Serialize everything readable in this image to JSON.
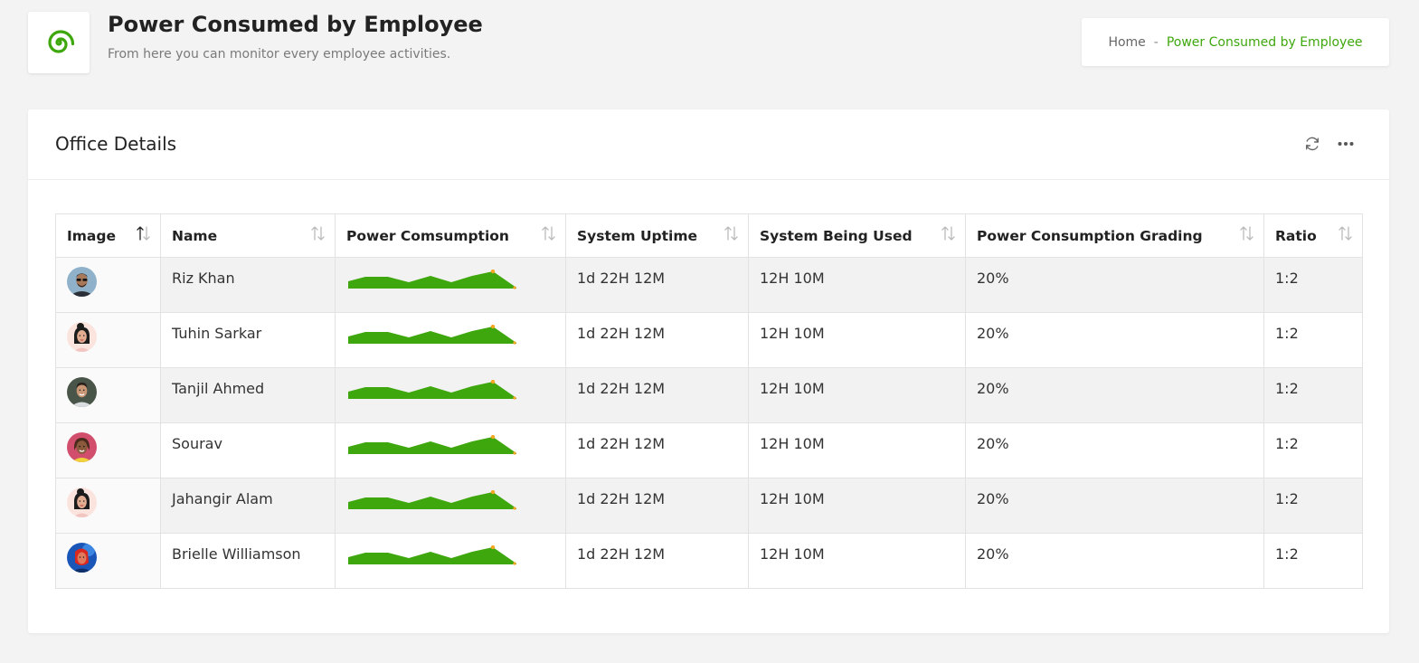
{
  "header": {
    "logo_icon": "green-spiral-logo",
    "title": "Power Consumed by Employee",
    "subtitle": "From here you can monitor every employee activities."
  },
  "breadcrumb": {
    "home": "Home",
    "separator": "-",
    "current": "Power Consumed by Employee"
  },
  "card": {
    "title": "Office Details",
    "tools": [
      "refresh-icon",
      "more-icon"
    ]
  },
  "table": {
    "columns": [
      "Image",
      "Name",
      "Power Comsumption",
      "System Uptime",
      "System Being Used",
      "Power Consumption Grading",
      "Ratio"
    ],
    "rows": [
      {
        "avatar": "man-with-sunglasses",
        "name": "Riz Khan",
        "uptime": "1d 22H 12M",
        "used": "12H 10M",
        "grading": "20%",
        "ratio": "1:2"
      },
      {
        "avatar": "woman-with-hair-bun",
        "name": "Tuhin Sarkar",
        "uptime": "1d 22H 12M",
        "used": "12H 10M",
        "grading": "20%",
        "ratio": "1:2"
      },
      {
        "avatar": "man-smiling",
        "name": "Tanjil Ahmed",
        "uptime": "1d 22H 12M",
        "used": "12H 10M",
        "grading": "20%",
        "ratio": "1:2"
      },
      {
        "avatar": "woman-red-background",
        "name": "Sourav",
        "uptime": "1d 22H 12M",
        "used": "12H 10M",
        "grading": "20%",
        "ratio": "1:2"
      },
      {
        "avatar": "woman-with-hair-bun",
        "name": "Jahangir Alam",
        "uptime": "1d 22H 12M",
        "used": "12H 10M",
        "grading": "20%",
        "ratio": "1:2"
      },
      {
        "avatar": "person-blue-background",
        "name": "Brielle Williamson",
        "uptime": "1d 22H 12M",
        "used": "12H 10M",
        "grading": "20%",
        "ratio": "1:2"
      }
    ]
  },
  "colors": {
    "accent": "#3ea70d",
    "sparkline_fill": "#3ea70d",
    "sparkline_marker": "#f5a623",
    "page_bg": "#f3f3f3"
  }
}
